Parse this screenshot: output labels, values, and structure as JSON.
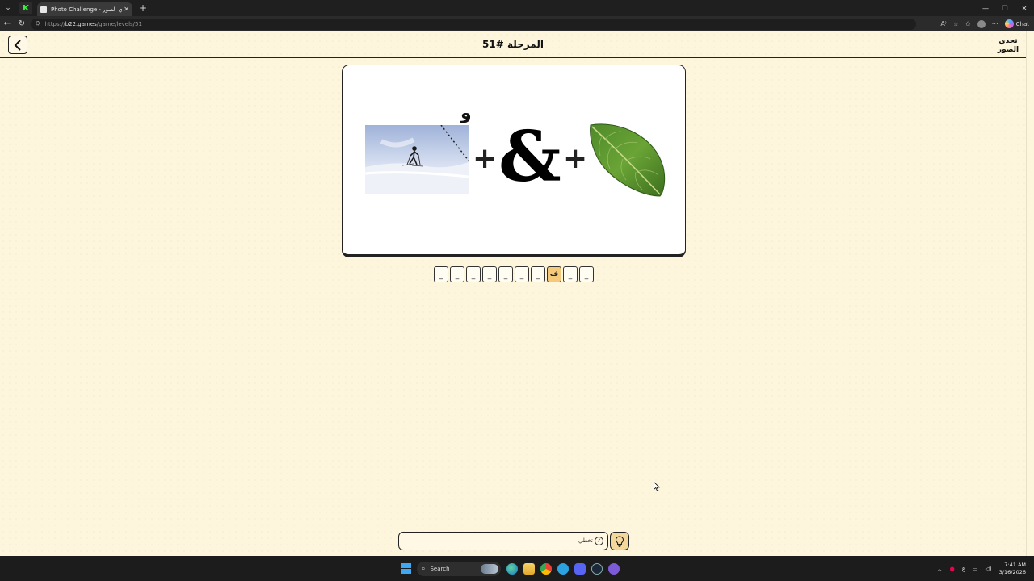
{
  "browser": {
    "tab_title": "Photo Challenge - لعبة تحدي الصور",
    "url_host": "b22.games",
    "url_prefix": "https://",
    "url_path": "/game/levels/51",
    "chat_label": "Chat"
  },
  "header": {
    "title": "المرحلة #51",
    "logo_text": "تحدي الصور"
  },
  "puzzle": {
    "diacritic": "و",
    "operator": "+",
    "symbol": "&"
  },
  "answer": {
    "slots": [
      "_",
      "_",
      "_",
      "_",
      "_",
      "_",
      "_",
      "ف",
      "_",
      "_"
    ],
    "revealed_index": 7,
    "input_value": "",
    "skip_label": "تخطي"
  },
  "taskbar": {
    "search_label": "Search",
    "keyboard_lang": "ع",
    "time": "7:41 AM",
    "date": "3/16/2026"
  },
  "colors": {
    "page_background": "#fdf6dc",
    "revealed_slot": "#f4c979",
    "hint_button": "#f4d79a"
  }
}
